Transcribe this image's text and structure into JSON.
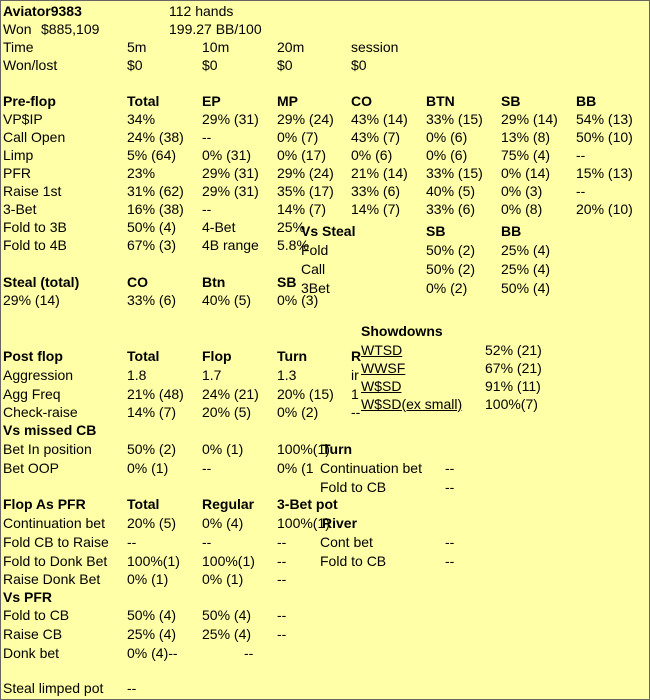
{
  "header": {
    "player": "Aviator9383",
    "hands": "112 hands",
    "won_label": "Won",
    "won_amount": "$885,109",
    "bb_rate": "199.27 BB/100"
  },
  "time_row": {
    "label": "Time",
    "cols": [
      "5m",
      "10m",
      "20m",
      "session"
    ]
  },
  "wonlost_row": {
    "label": "Won/lost",
    "cols": [
      "$0",
      "$0",
      "$0",
      "$0"
    ]
  },
  "preflop": {
    "heading": "Pre-flop",
    "col_headers": [
      "Total",
      "EP",
      "MP",
      "CO",
      "BTN",
      "SB",
      "BB"
    ],
    "rows": [
      {
        "label": "VP$IP",
        "cells": [
          "34%",
          "29%  (31)",
          "29%  (24)",
          "43%  (14)",
          "33%  (15)",
          "29%  (14)",
          "54%  (13)"
        ]
      },
      {
        "label": "Call Open",
        "cells": [
          "24%  (38)",
          "--",
          "0%    (7)",
          "43%  (7)",
          "0%    (6)",
          "13%  (8)",
          "50%  (10)"
        ]
      },
      {
        "label": "Limp",
        "cells": [
          "5%    (64)",
          "0%    (31)",
          "0%    (17)",
          "0%    (6)",
          "0%    (6)",
          "75%  (4)",
          "--"
        ]
      },
      {
        "label": "PFR",
        "cells": [
          "23%",
          "29%  (31)",
          "29%  (24)",
          "21%  (14)",
          "33%  (15)",
          "0%    (14)",
          "15%  (13)"
        ]
      },
      {
        "label": "Raise 1st",
        "cells": [
          "31%  (62)",
          "29%  (31)",
          "35%  (17)",
          "33%  (6)",
          "40%  (5)",
          "0%    (3)",
          "--"
        ]
      },
      {
        "label": "3-Bet",
        "cells": [
          "16%  (38)",
          "--",
          "14%  (7)",
          "14%  (7)",
          "33%  (6)",
          "0%    (8)",
          "20%  (10)"
        ]
      }
    ],
    "fold3b": {
      "label": "Fold to 3B",
      "value": "50%  (4)",
      "sub_label": "4-Bet",
      "sub_value": "25%"
    },
    "fold4b": {
      "label": "Fold to 4B",
      "value": "67%  (3)",
      "sub_label": "4B range",
      "sub_value": "5.8%"
    }
  },
  "vs_steal": {
    "heading": "Vs Steal",
    "col_headers": [
      "SB",
      "BB"
    ],
    "rows": [
      {
        "label": "Fold",
        "sb": "50%  (2)",
        "bb": "25%  (4)"
      },
      {
        "label": "Call",
        "sb": "50%  (2)",
        "bb": "25%  (4)"
      },
      {
        "label": "3Bet",
        "sb": "0%    (2)",
        "bb": "50%  (4)"
      }
    ]
  },
  "steal": {
    "heading": "Steal (total)",
    "value": "29%  (14)",
    "col_headers": [
      "CO",
      "Btn",
      "SB"
    ],
    "cells": [
      "33%  (6)",
      "40%  (5)",
      "0%    (3)"
    ]
  },
  "showdowns": {
    "heading": "Showdowns",
    "rows": [
      {
        "label": "WTSD",
        "value": "52%  (21)"
      },
      {
        "label": "WWSF",
        "value": "67%  (21)"
      },
      {
        "label": "W$SD",
        "value": "91%  (11)"
      },
      {
        "label": "W$SD(ex small)",
        "value": "100%(7)"
      }
    ]
  },
  "postflop": {
    "heading": "Post flop",
    "col_headers": [
      "Total",
      "Flop",
      "Turn",
      "R"
    ],
    "rows": [
      {
        "label": "Aggression",
        "cells": [
          "1.8",
          "1.7",
          "1.3",
          "ir"
        ]
      },
      {
        "label": "Agg Freq",
        "cells": [
          "21%  (48)",
          "24%  (21)",
          "20%  (15)",
          "1"
        ]
      },
      {
        "label": "Check-raise",
        "cells": [
          "14%  (7)",
          "20%  (5)",
          "0%    (2)",
          "--"
        ]
      }
    ]
  },
  "vs_missed_cb": {
    "heading": "Vs missed CB",
    "rows": [
      {
        "label": "Bet In position",
        "cells": [
          "50%  (2)",
          "0%    (1)",
          "100%(1)"
        ]
      },
      {
        "label": "Bet OOP",
        "cells": [
          "0%    (1)",
          "--",
          "0%    (1"
        ]
      }
    ]
  },
  "turn_box": {
    "heading": "Turn",
    "rows": [
      {
        "label": "Continuation bet",
        "value": "--"
      },
      {
        "label": "Fold to CB",
        "value": "--"
      }
    ]
  },
  "river_box": {
    "heading": "River",
    "rows": [
      {
        "label": "Cont bet",
        "value": "--"
      },
      {
        "label": "Fold to CB",
        "value": "--"
      }
    ]
  },
  "flop_pfr": {
    "heading": "Flop As PFR",
    "col_headers": [
      "Total",
      "Regular",
      "3-Bet pot"
    ],
    "rows": [
      {
        "label": "Continuation bet",
        "cells": [
          "20%  (5)",
          "0%    (4)",
          "100%(1)"
        ]
      },
      {
        "label": "Fold CB to Raise",
        "cells": [
          "--",
          "--",
          "--"
        ]
      },
      {
        "label": "Fold to Donk Bet",
        "cells": [
          "100%(1)",
          "100%(1)",
          "--"
        ]
      },
      {
        "label": "Raise Donk Bet",
        "cells": [
          "0%    (1)",
          "0%    (1)",
          "--"
        ]
      }
    ]
  },
  "vs_pfr": {
    "heading": "Vs PFR",
    "rows": [
      {
        "label": "Fold to CB",
        "cells": [
          "50%  (4)",
          "50%  (4)",
          "--"
        ]
      },
      {
        "label": "Raise CB",
        "cells": [
          "25%  (4)",
          "25%  (4)",
          "--"
        ]
      },
      {
        "label": "Donk bet",
        "cells": [
          "0%    (4)--",
          "--",
          ""
        ]
      }
    ]
  },
  "steal_limped": {
    "label": "Steal limped pot",
    "value": "--"
  }
}
